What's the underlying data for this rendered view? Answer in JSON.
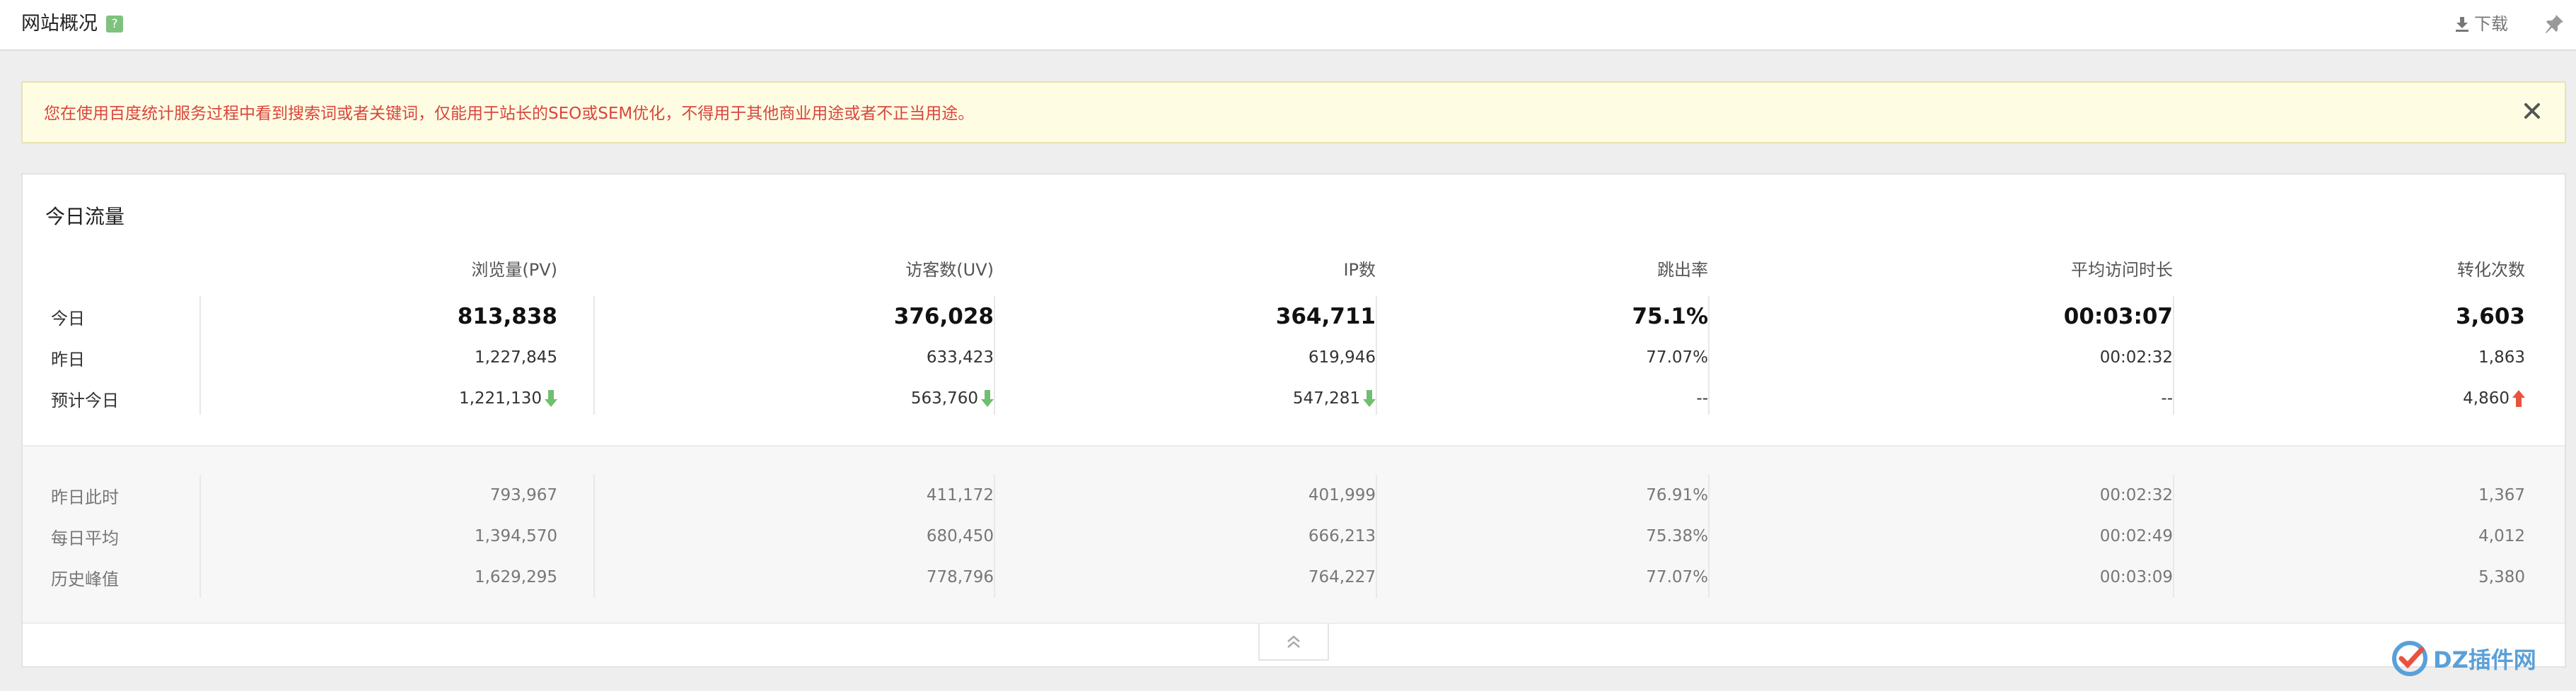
{
  "header": {
    "title": "网站概况",
    "help_badge": "?",
    "download_label": "下载"
  },
  "alert": {
    "message": "您在使用百度统计服务过程中看到搜索词或者关键词，仅能用于站长的SEO或SEM优化，不得用于其他商业用途或者不正当用途。"
  },
  "panel": {
    "title": "今日流量",
    "columns": [
      "浏览量(PV)",
      "访客数(UV)",
      "IP数",
      "跳出率",
      "平均访问时长",
      "转化次数"
    ],
    "rows": [
      {
        "label": "今日",
        "values": [
          "813,838",
          "376,028",
          "364,711",
          "75.1%",
          "00:03:07",
          "3,603"
        ]
      },
      {
        "label": "昨日",
        "values": [
          "1,227,845",
          "633,423",
          "619,946",
          "77.07%",
          "00:02:32",
          "1,863"
        ]
      },
      {
        "label": "预计今日",
        "values": [
          "1,221,130",
          "563,760",
          "547,281",
          "--",
          "--",
          "4,860"
        ],
        "trends": [
          "down",
          "down",
          "down",
          "",
          "",
          "up"
        ]
      }
    ],
    "history_rows": [
      {
        "label": "昨日此时",
        "values": [
          "793,967",
          "411,172",
          "401,999",
          "76.91%",
          "00:02:32",
          "1,367"
        ]
      },
      {
        "label": "每日平均",
        "values": [
          "1,394,570",
          "680,450",
          "666,213",
          "75.38%",
          "00:02:49",
          "4,012"
        ]
      },
      {
        "label": "历史峰值",
        "values": [
          "1,629,295",
          "778,796",
          "764,227",
          "77.07%",
          "00:03:09",
          "5,380"
        ]
      }
    ]
  },
  "colors": {
    "trend_down": "#6fbf6f",
    "trend_up": "#e8533f",
    "alert_text": "#d9453d"
  },
  "watermark": {
    "text": "DZ插件网"
  }
}
